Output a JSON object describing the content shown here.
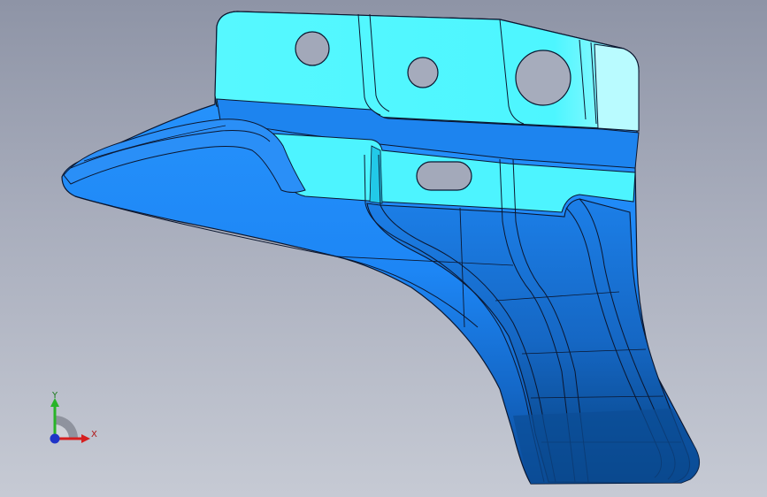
{
  "viewport": {
    "background_top": "#8e94a6",
    "background_bottom": "#c6cad4"
  },
  "model": {
    "name": "sheet-metal-bracket",
    "colors": {
      "face_light": "#4dfbff",
      "face_pale": "#b9fbff",
      "face_mid": "#1f8bff",
      "face_dark": "#0a52a8",
      "face_shadow": "#06407f",
      "edge": "#0b1730"
    }
  },
  "triad": {
    "x_label": "X",
    "y_label": "Y",
    "x_color": "#d61f1f",
    "y_color": "#28b428",
    "z_color": "#1f34c8"
  }
}
